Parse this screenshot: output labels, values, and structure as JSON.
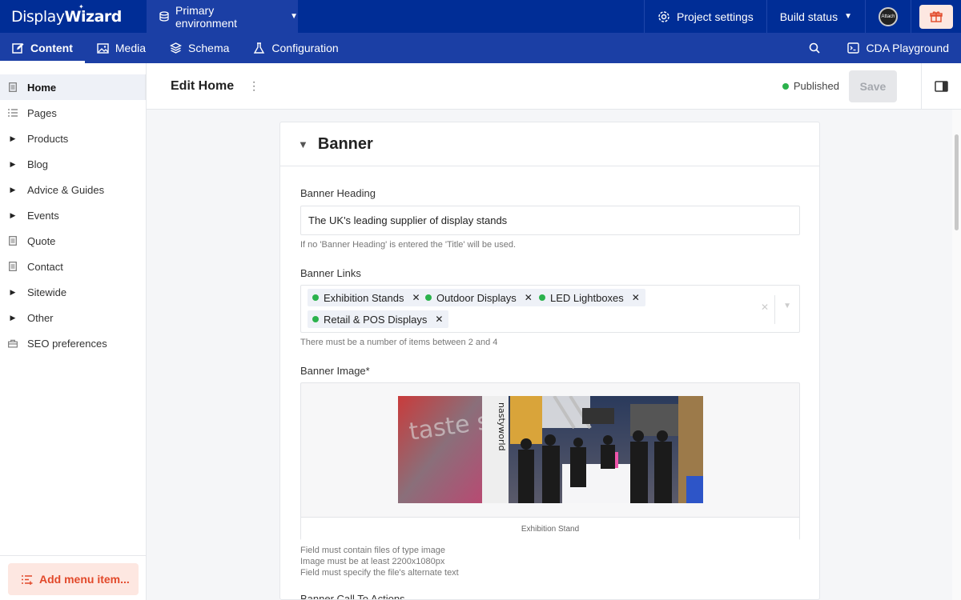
{
  "brand": {
    "part1": "Display",
    "part2": "Wizard"
  },
  "environment": {
    "label": "Primary environment"
  },
  "topbar": {
    "project_settings": "Project settings",
    "build_status": "Build status",
    "avatar_text": "Attach"
  },
  "nav": {
    "tabs": [
      {
        "label": "Content",
        "active": true
      },
      {
        "label": "Media"
      },
      {
        "label": "Schema"
      },
      {
        "label": "Configuration"
      }
    ],
    "cda_playground": "CDA Playground"
  },
  "sidebar": {
    "items": [
      {
        "label": "Home",
        "icon": "page-icon",
        "active": true
      },
      {
        "label": "Pages",
        "icon": "list-icon"
      },
      {
        "label": "Products",
        "icon": "caret-right-icon"
      },
      {
        "label": "Blog",
        "icon": "caret-right-icon"
      },
      {
        "label": "Advice & Guides",
        "icon": "caret-right-icon"
      },
      {
        "label": "Events",
        "icon": "caret-right-icon"
      },
      {
        "label": "Quote",
        "icon": "page-icon"
      },
      {
        "label": "Contact",
        "icon": "page-icon"
      },
      {
        "label": "Sitewide",
        "icon": "caret-right-icon"
      },
      {
        "label": "Other",
        "icon": "caret-right-icon"
      },
      {
        "label": "SEO preferences",
        "icon": "toolbox-icon"
      }
    ],
    "add_menu_item": "Add menu item..."
  },
  "editor": {
    "title": "Edit Home",
    "status": "Published",
    "save_label": "Save",
    "status_color": "#2bb24c"
  },
  "banner": {
    "section_title": "Banner",
    "heading_label": "Banner Heading",
    "heading_value": "The UK's leading supplier of display stands",
    "heading_help": "If no 'Banner Heading' is entered the 'Title' will be used.",
    "links_label": "Banner Links",
    "links": [
      "Exhibition Stands",
      "Outdoor Displays",
      "LED Lightboxes",
      "Retail & POS Displays"
    ],
    "links_help": "There must be a number of items between 2 and 4",
    "image_label": "Banner Image*",
    "image_caption": "Exhibition Stand",
    "image_help": [
      "Field must contain files of type image",
      "Image must be at least 2200x1080px",
      "Field must specify the file's alternate text"
    ],
    "cta_label": "Banner Call To Actions",
    "photo_text": {
      "brand_vertical": "nastyworld",
      "graffiti": "taste style"
    }
  },
  "colors": {
    "primary": "#002d96",
    "nav": "#1b3fa5",
    "accent": "#e2492a"
  }
}
